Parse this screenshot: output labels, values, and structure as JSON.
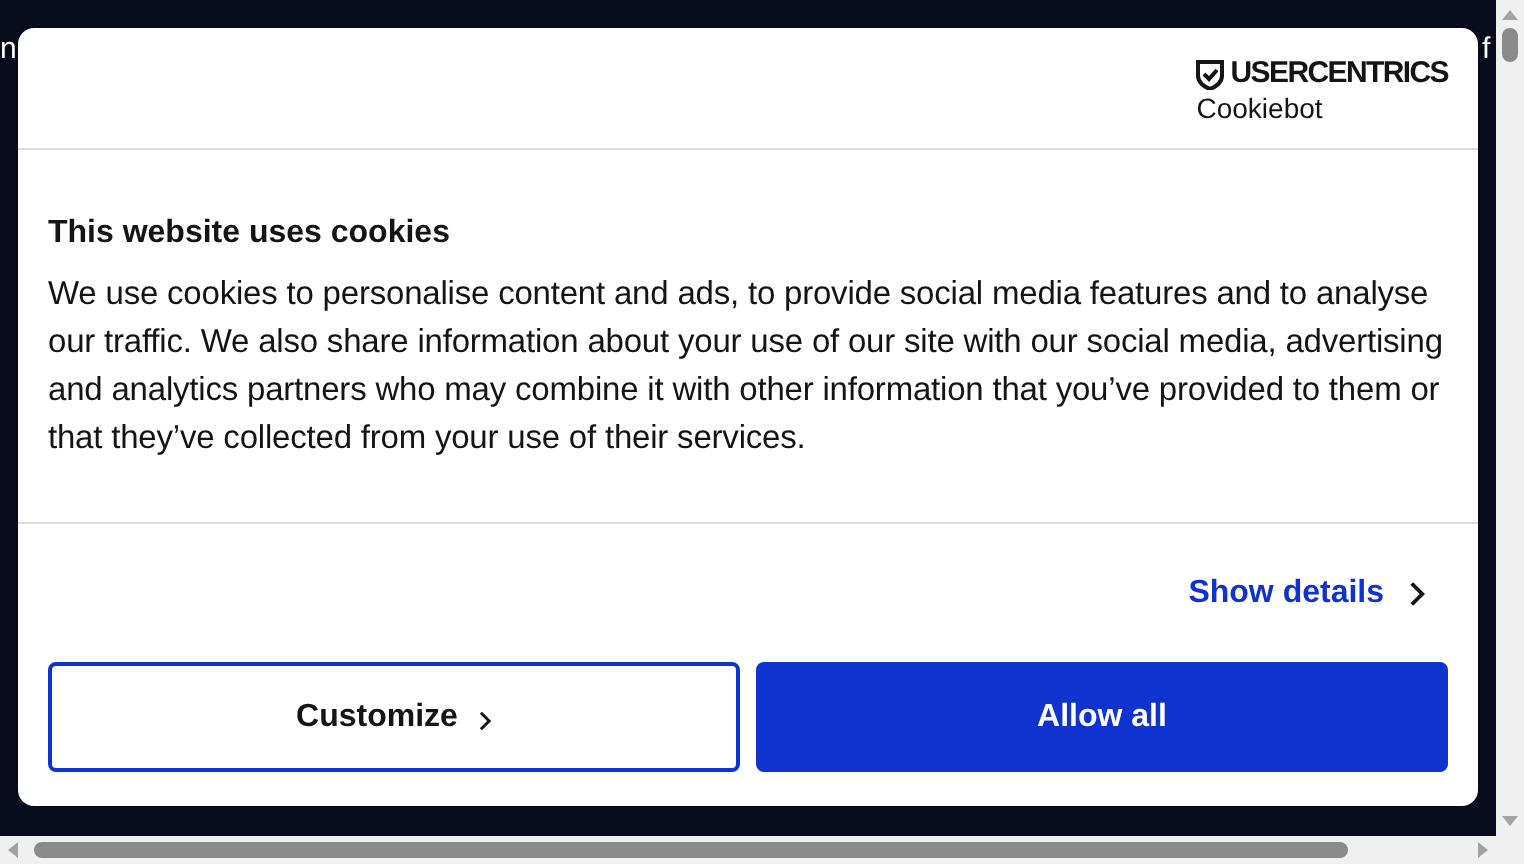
{
  "background": {
    "left_fragment": "n",
    "right_fragment": "f"
  },
  "dialog": {
    "logo": {
      "brand": "USERCENTRICS",
      "product": "Cookiebot"
    },
    "title": "This website uses cookies",
    "body": "We use cookies to personalise content and ads, to provide social media features and to analyse our traffic. We also share information about your use of our site with our social media, advertising and analytics partners who may combine it with other information that you’ve provided to them or that they’ve collected from your use of their services.",
    "details_link": "Show details",
    "buttons": [
      {
        "label": "Customize",
        "kind": "outline"
      },
      {
        "label": "Allow all",
        "kind": "primary"
      }
    ]
  }
}
